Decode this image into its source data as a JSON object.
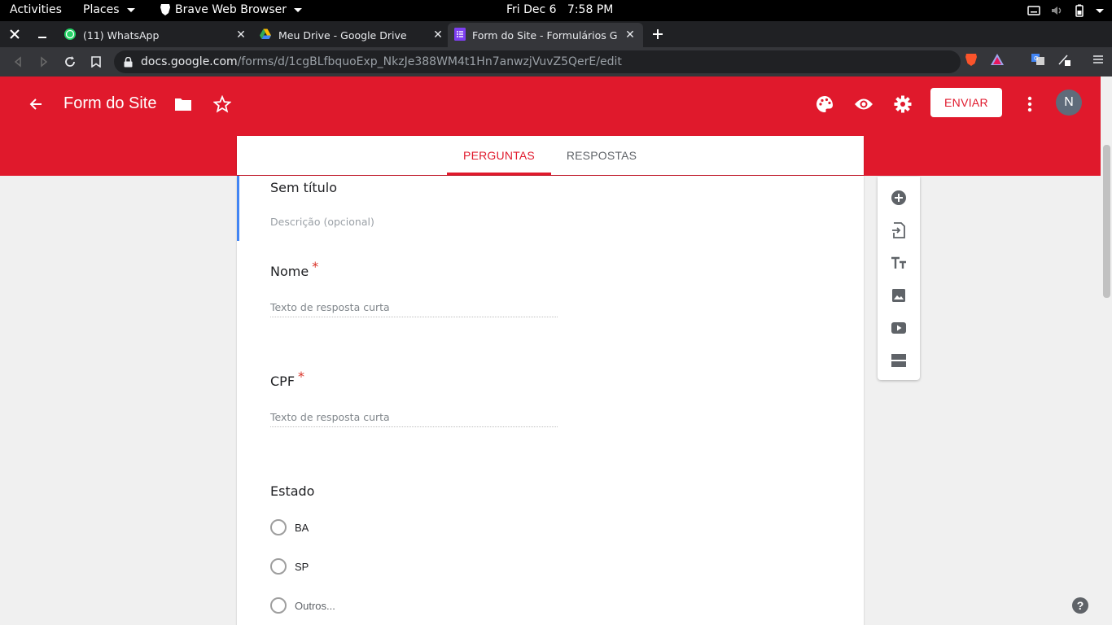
{
  "system_bar": {
    "activities": "Activities",
    "places": "Places",
    "app_name": "Brave Web Browser",
    "clock": "Fri Dec 6   7:58 PM"
  },
  "browser": {
    "tabs": [
      {
        "title": "(11) WhatsApp",
        "icon": "whatsapp-icon"
      },
      {
        "title": "Meu Drive - Google Drive",
        "icon": "google-drive-icon"
      },
      {
        "title": "Form do Site - Formulários Goo",
        "icon": "google-forms-icon"
      }
    ],
    "url_host": "docs.google.com",
    "url_path": "/forms/d/1cgBLfbquoExp_NkzJe388WM4t1Hn7anwzjVuvZ5QerE/edit"
  },
  "header": {
    "form_title": "Form do Site",
    "send_label": "ENVIAR",
    "avatar_letter": "N",
    "accent_color": "#e0192c"
  },
  "form_tabs": {
    "questions": "PERGUNTAS",
    "responses": "RESPOSTAS"
  },
  "form": {
    "section_title": "Sem título",
    "section_desc": "Descrição (opcional)",
    "questions": [
      {
        "title": "Nome",
        "required": true,
        "placeholder": "Texto de resposta curta"
      },
      {
        "title": "CPF",
        "required": true,
        "placeholder": "Texto de resposta curta"
      },
      {
        "title": "Estado",
        "required": false,
        "options": [
          "BA",
          "SP",
          "Outros..."
        ]
      }
    ],
    "required_mark": "*"
  },
  "help_label": "?"
}
